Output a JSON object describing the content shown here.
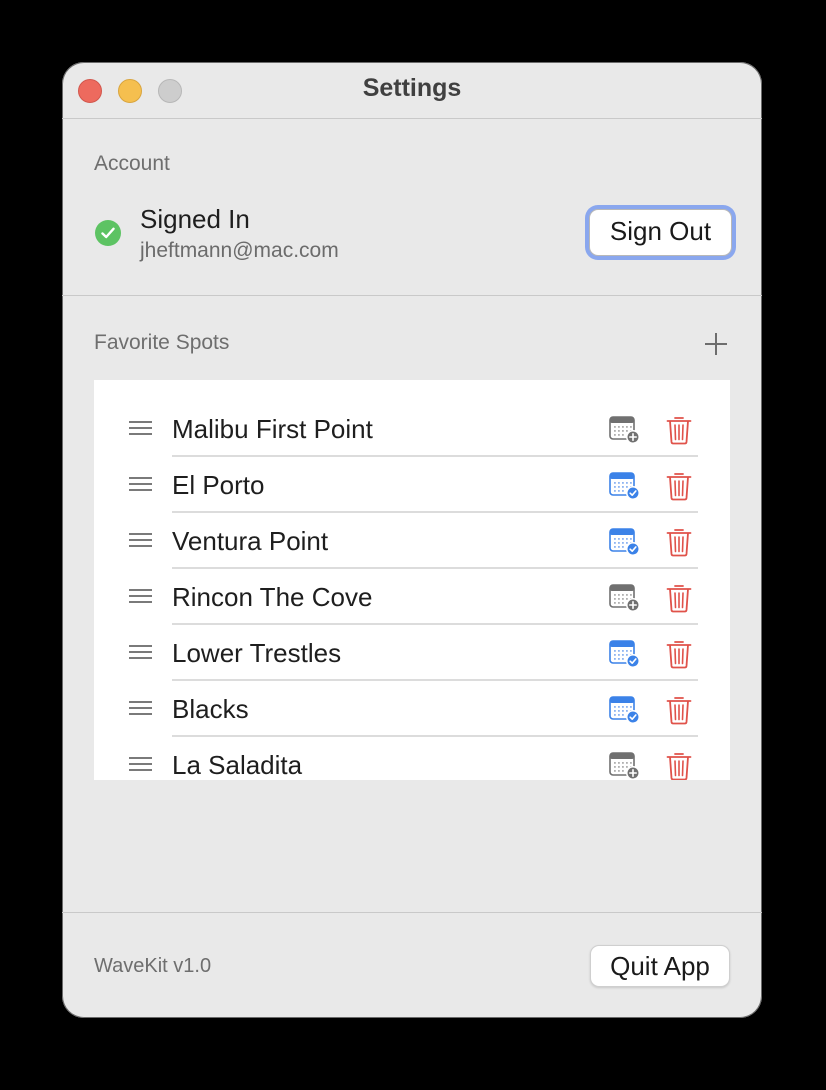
{
  "window": {
    "title": "Settings"
  },
  "account": {
    "section_label": "Account",
    "status": "Signed In",
    "email": "jheftmann@mac.com",
    "sign_out_label": "Sign Out"
  },
  "favorites": {
    "section_label": "Favorite Spots",
    "items": [
      {
        "name": "Malibu First Point",
        "calendar": "calendar-add-icon"
      },
      {
        "name": "El Porto",
        "calendar": "calendar-checked-icon"
      },
      {
        "name": "Ventura Point",
        "calendar": "calendar-checked-icon"
      },
      {
        "name": "Rincon The Cove",
        "calendar": "calendar-add-icon"
      },
      {
        "name": "Lower Trestles",
        "calendar": "calendar-checked-icon"
      },
      {
        "name": "Blacks",
        "calendar": "calendar-checked-icon"
      },
      {
        "name": "La Saladita",
        "calendar": "calendar-add-icon"
      }
    ]
  },
  "footer": {
    "version": "WaveKit v1.0",
    "quit_label": "Quit App"
  },
  "colors": {
    "status_green": "#5dc363",
    "focus_ring": "#8aa7ee",
    "calendar_blue": "#3b82e8",
    "calendar_gray": "#707070",
    "trash_red": "#e0524a"
  }
}
